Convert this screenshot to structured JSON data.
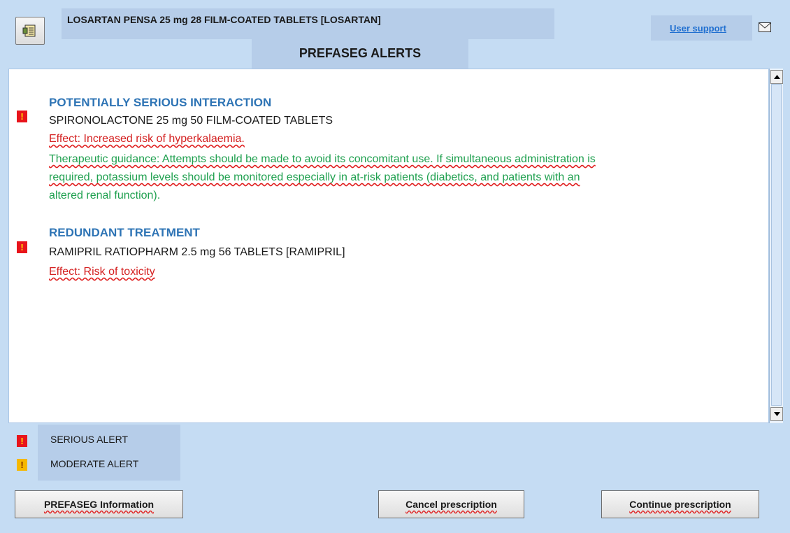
{
  "header": {
    "drug_title": "LOSARTAN PENSA 25 mg 28 FILM-COATED TABLETS [LOSARTAN]",
    "alerts_title": "PREFASEG ALERTS",
    "user_support": "User support",
    "app_icon": "document-icon",
    "mail_icon": "envelope-icon"
  },
  "alerts": [
    {
      "level": "serious",
      "title": "POTENTIALLY SERIOUS INTERACTION",
      "drug": "SPIRONOLACTONE 25 mg 50 FILM-COATED TABLETS",
      "effect": "Effect: Increased risk of hyperkalaemia.",
      "guidance_line1": "Therapeutic guidance: Attempts should be made to avoid its concomitant use. If simultaneous administration is",
      "guidance_line2": "required, potassium levels should be monitored especially in at-risk patients (diabetics, and patients with an",
      "guidance_line3": "altered renal function)."
    },
    {
      "level": "serious",
      "title": "REDUNDANT TREATMENT",
      "drug": "RAMIPRIL RATIOPHARM 2.5 mg 56 TABLETS [RAMIPRIL]",
      "effect": "Effect: Risk of toxicity"
    }
  ],
  "legend": {
    "serious": "SERIOUS ALERT",
    "moderate": "MODERATE ALERT"
  },
  "buttons": {
    "info": "PREFASEG Information",
    "cancel": "Cancel prescription",
    "continue": "Continue prescription"
  },
  "icon_glyph": "!",
  "colors": {
    "serious": "#e8141b",
    "moderate": "#f5b800",
    "section_title": "#2e74b5",
    "effect": "#d42020",
    "guidance": "#1fa04f",
    "link": "#1f6fd0"
  }
}
